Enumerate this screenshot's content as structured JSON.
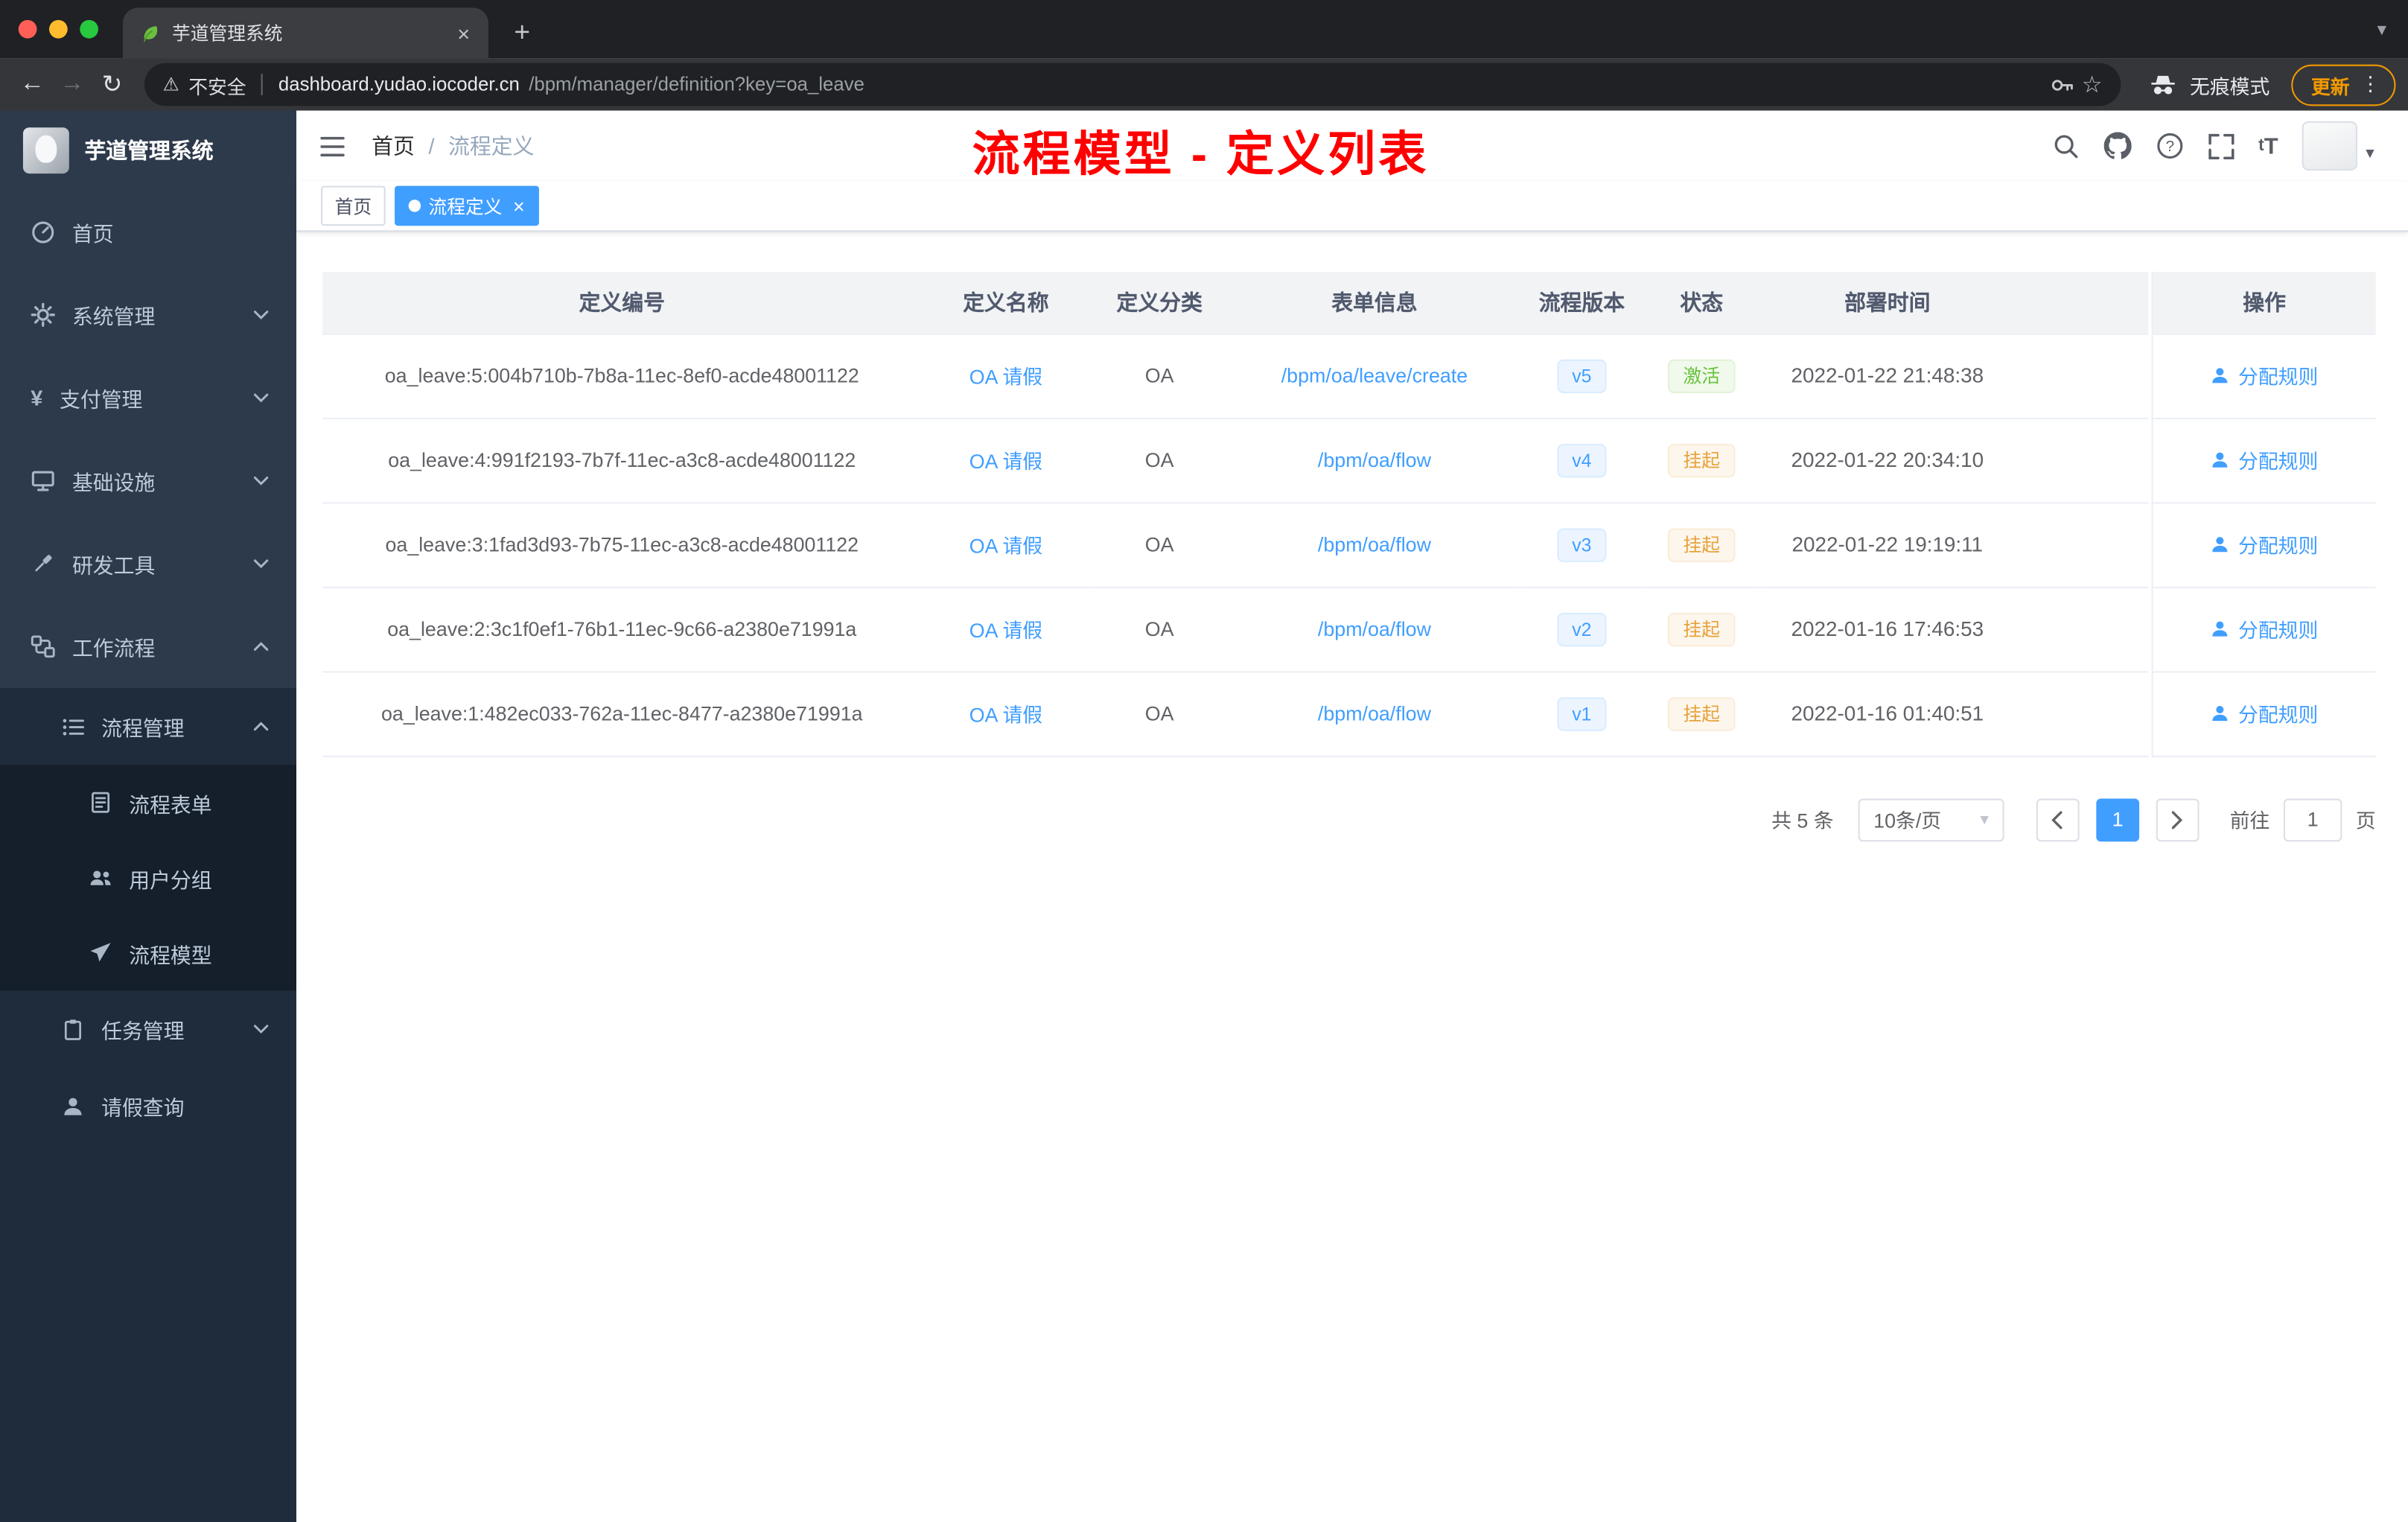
{
  "browser": {
    "tab": {
      "title": "芋道管理系统"
    },
    "address": {
      "security": "不安全",
      "host": "dashboard.yudao.iocoder.cn",
      "path": "/bpm/manager/definition?key=oa_leave"
    },
    "incognito_label": "无痕模式",
    "update_label": "更新"
  },
  "sidebar": {
    "app_title": "芋道管理系统",
    "menu": [
      {
        "label": "首页"
      },
      {
        "label": "系统管理"
      },
      {
        "label": "支付管理"
      },
      {
        "label": "基础设施"
      },
      {
        "label": "研发工具"
      },
      {
        "label": "工作流程"
      },
      {
        "label": "流程管理"
      },
      {
        "label": "流程表单"
      },
      {
        "label": "用户分组"
      },
      {
        "label": "流程模型"
      },
      {
        "label": "任务管理"
      },
      {
        "label": "请假查询"
      }
    ]
  },
  "header": {
    "breadcrumb_home": "首页",
    "breadcrumb_separator": "/",
    "breadcrumb_current": "流程定义",
    "annotation": "流程模型 - 定义列表"
  },
  "tags": {
    "home": "首页",
    "active": "流程定义"
  },
  "table": {
    "columns": {
      "id": "定义编号",
      "name": "定义名称",
      "category": "定义分类",
      "form": "表单信息",
      "version": "流程版本",
      "status": "状态",
      "deploy_time": "部署时间",
      "actions": "操作"
    },
    "rows": [
      {
        "id": "oa_leave:5:004b710b-7b8a-11ec-8ef0-acde48001122",
        "name": "OA 请假",
        "category": "OA",
        "form": "/bpm/oa/leave/create",
        "version": "v5",
        "status": "激活",
        "status_type": "success",
        "deploy_time": "2022-01-22 21:48:38",
        "action": "分配规则"
      },
      {
        "id": "oa_leave:4:991f2193-7b7f-11ec-a3c8-acde48001122",
        "name": "OA 请假",
        "category": "OA",
        "form": "/bpm/oa/flow",
        "version": "v4",
        "status": "挂起",
        "status_type": "warning",
        "deploy_time": "2022-01-22 20:34:10",
        "action": "分配规则"
      },
      {
        "id": "oa_leave:3:1fad3d93-7b75-11ec-a3c8-acde48001122",
        "name": "OA 请假",
        "category": "OA",
        "form": "/bpm/oa/flow",
        "version": "v3",
        "status": "挂起",
        "status_type": "warning",
        "deploy_time": "2022-01-22 19:19:11",
        "action": "分配规则"
      },
      {
        "id": "oa_leave:2:3c1f0ef1-76b1-11ec-9c66-a2380e71991a",
        "name": "OA 请假",
        "category": "OA",
        "form": "/bpm/oa/flow",
        "version": "v2",
        "status": "挂起",
        "status_type": "warning",
        "deploy_time": "2022-01-16 17:46:53",
        "action": "分配规则"
      },
      {
        "id": "oa_leave:1:482ec033-762a-11ec-8477-a2380e71991a",
        "name": "OA 请假",
        "category": "OA",
        "form": "/bpm/oa/flow",
        "version": "v1",
        "status": "挂起",
        "status_type": "warning",
        "deploy_time": "2022-01-16 01:40:51",
        "action": "分配规则"
      }
    ]
  },
  "pagination": {
    "total": "共 5 条",
    "page_size": "10条/页",
    "current_page": "1",
    "goto_label": "前往",
    "goto_value": "1",
    "page_unit": "页"
  },
  "colors": {
    "accent": "#409eff",
    "success": "#67c23a",
    "warning": "#e6a23c",
    "annotation_red": "#ff0000",
    "update_orange": "#f29900"
  }
}
